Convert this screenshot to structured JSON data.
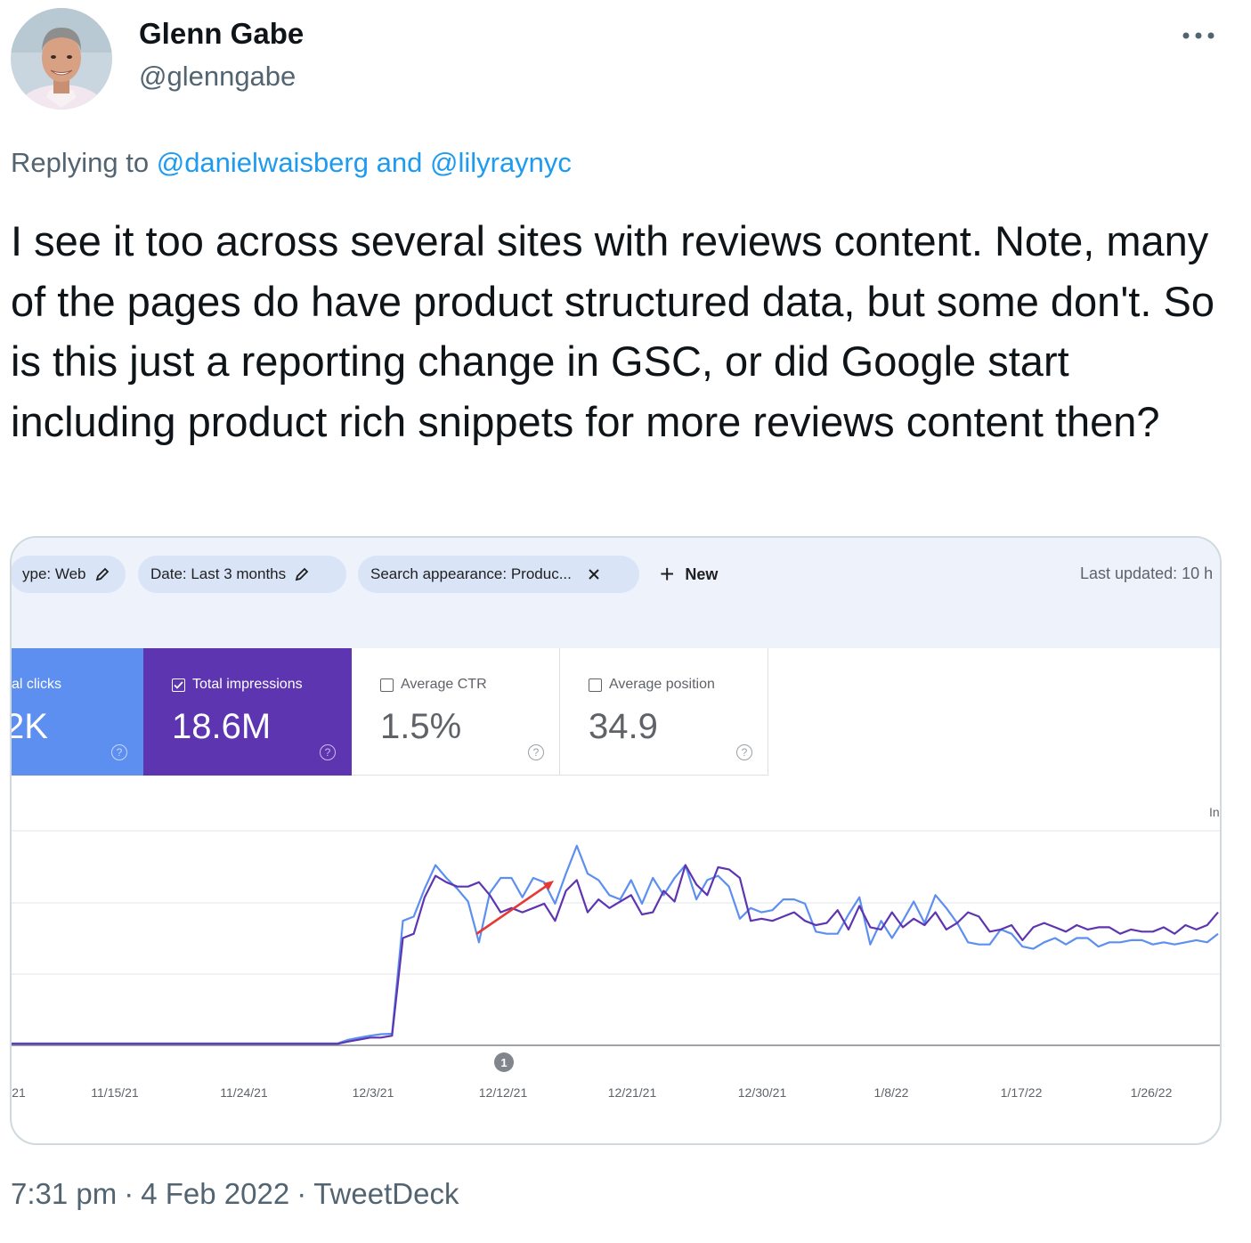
{
  "tweet": {
    "author_name": "Glenn Gabe",
    "author_handle": "@glenngabe",
    "more_icon": "more-horizontal-icon",
    "reply_prefix": "Replying to",
    "reply_user_1": "@danielwaisberg",
    "reply_and": "and",
    "reply_user_2": "@lilyraynyc",
    "text": "I see it too across several sites with reviews content. Note, many of the pages do have product structured data, but some don't. So is this just a reporting change in GSC, or did Google start including product rich snippets for more reviews content then?",
    "time": "7:31 pm",
    "date": "4 Feb 2022",
    "source": "TweetDeck",
    "separator": "·"
  },
  "gsc": {
    "filters": [
      {
        "label": "ype: Web",
        "icon": "pencil-icon"
      },
      {
        "label": "Date: Last 3 months",
        "icon": "pencil-icon"
      },
      {
        "label": "Search appearance: Produc...",
        "icon": "close-icon"
      }
    ],
    "new_label": "New",
    "last_updated": "Last updated: 10 h",
    "metrics": [
      {
        "label": "al clicks",
        "value": "2K",
        "checked": true
      },
      {
        "label": "Total impressions",
        "value": "18.6M",
        "checked": true
      },
      {
        "label": "Average CTR",
        "value": "1.5%",
        "checked": false
      },
      {
        "label": "Average position",
        "value": "34.9",
        "checked": false
      }
    ],
    "help_glyph": "?",
    "colors": {
      "clicks": "#5c8ff0",
      "impressions": "#5e35b1",
      "arrow": "#e53935"
    }
  },
  "chart_data": {
    "type": "line",
    "title": "",
    "axis_label_right": "In",
    "x_tick_labels": [
      "21",
      "11/15/21",
      "11/24/21",
      "12/3/21",
      "12/12/21",
      "12/21/21",
      "12/30/21",
      "1/8/22",
      "1/17/22",
      "1/26/22"
    ],
    "annotation_marker": "1",
    "y_relative_range": [
      0,
      1
    ],
    "series": [
      {
        "color": "#5c8ff0",
        "values": [
          0.009,
          0.009,
          0.009,
          0.009,
          0.009,
          0.009,
          0.009,
          0.009,
          0.009,
          0.009,
          0.009,
          0.009,
          0.009,
          0.009,
          0.009,
          0.009,
          0.009,
          0.009,
          0.009,
          0.009,
          0.009,
          0.009,
          0.009,
          0.009,
          0.009,
          0.009,
          0.009,
          0.009,
          0.009,
          0.009,
          0.009,
          0.026,
          0.036,
          0.045,
          0.052,
          0.054,
          0.58,
          0.6,
          0.73,
          0.84,
          0.78,
          0.73,
          0.67,
          0.48,
          0.71,
          0.78,
          0.78,
          0.69,
          0.78,
          0.76,
          0.66,
          0.8,
          0.93,
          0.8,
          0.77,
          0.7,
          0.68,
          0.77,
          0.66,
          0.78,
          0.7,
          0.78,
          0.84,
          0.68,
          0.77,
          0.79,
          0.74,
          0.59,
          0.64,
          0.62,
          0.63,
          0.68,
          0.68,
          0.66,
          0.53,
          0.52,
          0.52,
          0.61,
          0.69,
          0.47,
          0.58,
          0.5,
          0.58,
          0.67,
          0.57,
          0.7,
          0.64,
          0.57,
          0.48,
          0.47,
          0.47,
          0.54,
          0.52,
          0.46,
          0.45,
          0.48,
          0.5,
          0.47,
          0.5,
          0.5,
          0.46,
          0.48,
          0.48,
          0.49,
          0.49,
          0.47,
          0.48,
          0.47,
          0.48,
          0.49,
          0.48,
          0.52
        ]
      },
      {
        "color": "#5e35b1",
        "values": [
          0.007,
          0.007,
          0.007,
          0.007,
          0.007,
          0.007,
          0.007,
          0.007,
          0.007,
          0.007,
          0.007,
          0.007,
          0.007,
          0.007,
          0.007,
          0.007,
          0.007,
          0.007,
          0.007,
          0.007,
          0.007,
          0.007,
          0.007,
          0.007,
          0.007,
          0.007,
          0.007,
          0.007,
          0.007,
          0.007,
          0.007,
          0.018,
          0.027,
          0.036,
          0.036,
          0.045,
          0.5,
          0.52,
          0.69,
          0.79,
          0.76,
          0.74,
          0.74,
          0.76,
          0.7,
          0.62,
          0.64,
          0.62,
          0.64,
          0.66,
          0.58,
          0.72,
          0.77,
          0.62,
          0.68,
          0.64,
          0.67,
          0.7,
          0.61,
          0.62,
          0.72,
          0.67,
          0.84,
          0.75,
          0.7,
          0.83,
          0.82,
          0.78,
          0.58,
          0.59,
          0.58,
          0.6,
          0.62,
          0.58,
          0.56,
          0.57,
          0.63,
          0.54,
          0.65,
          0.55,
          0.54,
          0.62,
          0.55,
          0.59,
          0.56,
          0.62,
          0.54,
          0.57,
          0.62,
          0.6,
          0.53,
          0.54,
          0.56,
          0.49,
          0.55,
          0.57,
          0.55,
          0.53,
          0.56,
          0.54,
          0.55,
          0.55,
          0.52,
          0.54,
          0.53,
          0.53,
          0.55,
          0.52,
          0.56,
          0.54,
          0.56,
          0.62
        ]
      }
    ]
  }
}
